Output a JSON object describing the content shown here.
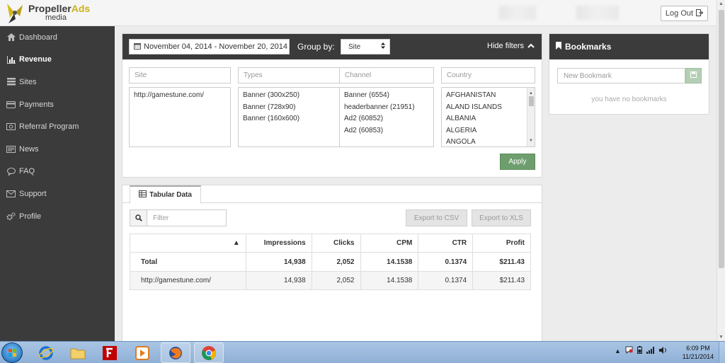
{
  "brand": {
    "name_part1": "Propeller",
    "name_part2": "Ads",
    "name_line2": "media",
    "accent_color": "#c9b21c"
  },
  "header": {
    "logout_label": "Log Out"
  },
  "sidebar": {
    "items": [
      {
        "label": "Dashboard",
        "icon": "home-icon",
        "active": false
      },
      {
        "label": "Revenue",
        "icon": "bar-chart-icon",
        "active": true
      },
      {
        "label": "Sites",
        "icon": "list-icon",
        "active": false
      },
      {
        "label": "Payments",
        "icon": "credit-card-icon",
        "active": false
      },
      {
        "label": "Referral Program",
        "icon": "money-icon",
        "active": false
      },
      {
        "label": "News",
        "icon": "newspaper-icon",
        "active": false
      },
      {
        "label": "FAQ",
        "icon": "comment-icon",
        "active": false
      },
      {
        "label": "Support",
        "icon": "envelope-icon",
        "active": false
      },
      {
        "label": "Profile",
        "icon": "gears-icon",
        "active": false
      }
    ]
  },
  "filters": {
    "date_range": "November 04, 2014 - November 20, 2014",
    "group_by_label": "Group by:",
    "group_by_value": "Site",
    "hide_filters_label": "Hide filters",
    "columns": [
      {
        "placeholder": "Site",
        "items": [
          "http://gamestune.com/"
        ]
      },
      {
        "placeholder": "Types",
        "items": [
          "Banner (300x250)",
          "Banner (728x90)",
          "Banner (160x600)"
        ]
      },
      {
        "placeholder": "Channel",
        "items": [
          "Banner (6554)",
          "headerbanner (21951)",
          "Ad2 (60852)",
          "Ad2 (60853)"
        ]
      },
      {
        "placeholder": "Country",
        "items": [
          "AFGHANISTAN",
          "ALAND ISLANDS",
          "ALBANIA",
          "ALGERIA",
          "ANGOLA"
        ]
      }
    ],
    "apply_label": "Apply",
    "apply_color": "#6e9e6e"
  },
  "data_view": {
    "tab_label": "Tabular Data",
    "filter_placeholder": "Filter",
    "export_csv_label": "Export to CSV",
    "export_xls_label": "Export to XLS",
    "table": {
      "headers": [
        "",
        "Impressions",
        "Clicks",
        "CPM",
        "CTR",
        "Profit"
      ],
      "total_row": [
        "Total",
        "14,938",
        "2,052",
        "14.1538",
        "0.1374",
        "$211.43"
      ],
      "rows": [
        [
          "http://gamestune.com/",
          "14,938",
          "2,052",
          "14.1538",
          "0.1374",
          "$211.43"
        ]
      ]
    }
  },
  "bookmarks": {
    "title": "Bookmarks",
    "input_placeholder": "New Bookmark",
    "empty_text": "you have no bookmarks"
  },
  "taskbar": {
    "time": "6:09 PM",
    "date": "11/21/2014"
  }
}
